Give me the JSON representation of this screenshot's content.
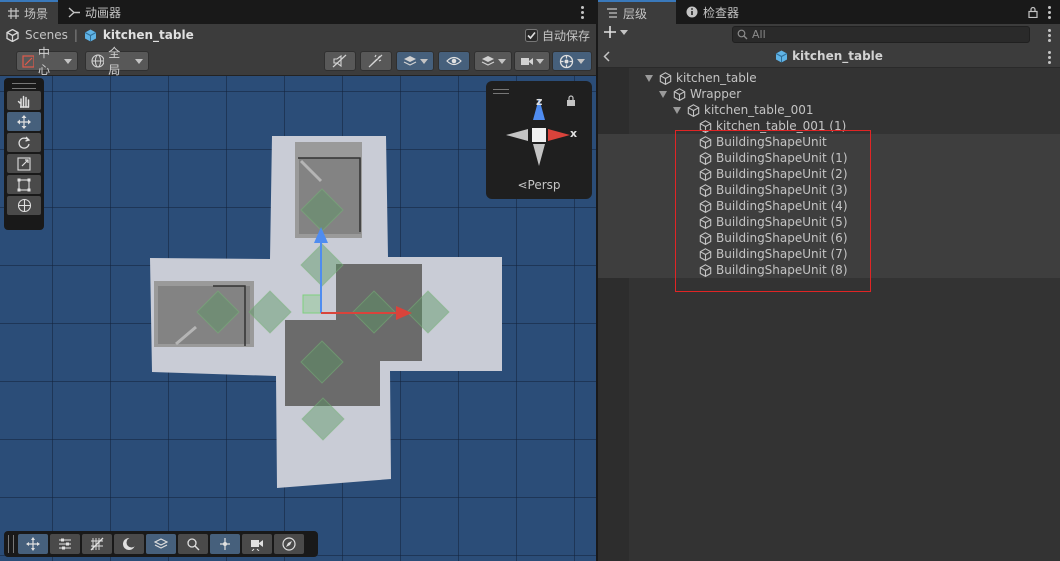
{
  "scene_panel": {
    "tabs": [
      {
        "label": "场景",
        "icon": "grid-icon",
        "active": true
      },
      {
        "label": "动画器",
        "icon": "animator-icon",
        "active": false
      }
    ],
    "breadcrumb": {
      "root": "Scenes",
      "current": "kitchen_table"
    },
    "autosave_label": "自动保存",
    "autosave_checked": true,
    "toolbar": {
      "pivot_label": "中心",
      "space_label": "全局"
    },
    "gizmo_label": "Persp",
    "gizmo_axes": {
      "x": "x",
      "z": "z"
    }
  },
  "hierarchy_panel": {
    "tabs": [
      {
        "label": "层级",
        "icon": "hierarchy-icon",
        "active": true
      },
      {
        "label": "检查器",
        "icon": "info-icon",
        "active": false
      }
    ],
    "search_placeholder": "All",
    "header_title": "kitchen_table",
    "tree": [
      {
        "label": "kitchen_table",
        "expanded": true
      },
      {
        "label": "Wrapper",
        "expanded": true
      },
      {
        "label": "kitchen_table_001",
        "expanded": true
      },
      {
        "label": "kitchen_table_001 (1)"
      },
      {
        "label": "BuildingShapeUnit"
      },
      {
        "label": "BuildingShapeUnit (1)"
      },
      {
        "label": "BuildingShapeUnit (2)"
      },
      {
        "label": "BuildingShapeUnit (3)"
      },
      {
        "label": "BuildingShapeUnit (4)"
      },
      {
        "label": "BuildingShapeUnit (5)"
      },
      {
        "label": "BuildingShapeUnit (6)"
      },
      {
        "label": "BuildingShapeUnit (7)"
      },
      {
        "label": "BuildingShapeUnit (8)"
      }
    ]
  },
  "colors": {
    "accent": "#3a79bb",
    "viewport_bg": "#2b4d78",
    "selection_box": "#e02525",
    "axis_x": "#d9433b",
    "axis_y": "#4f8cf0",
    "axis_z": "#4f8cf0"
  }
}
